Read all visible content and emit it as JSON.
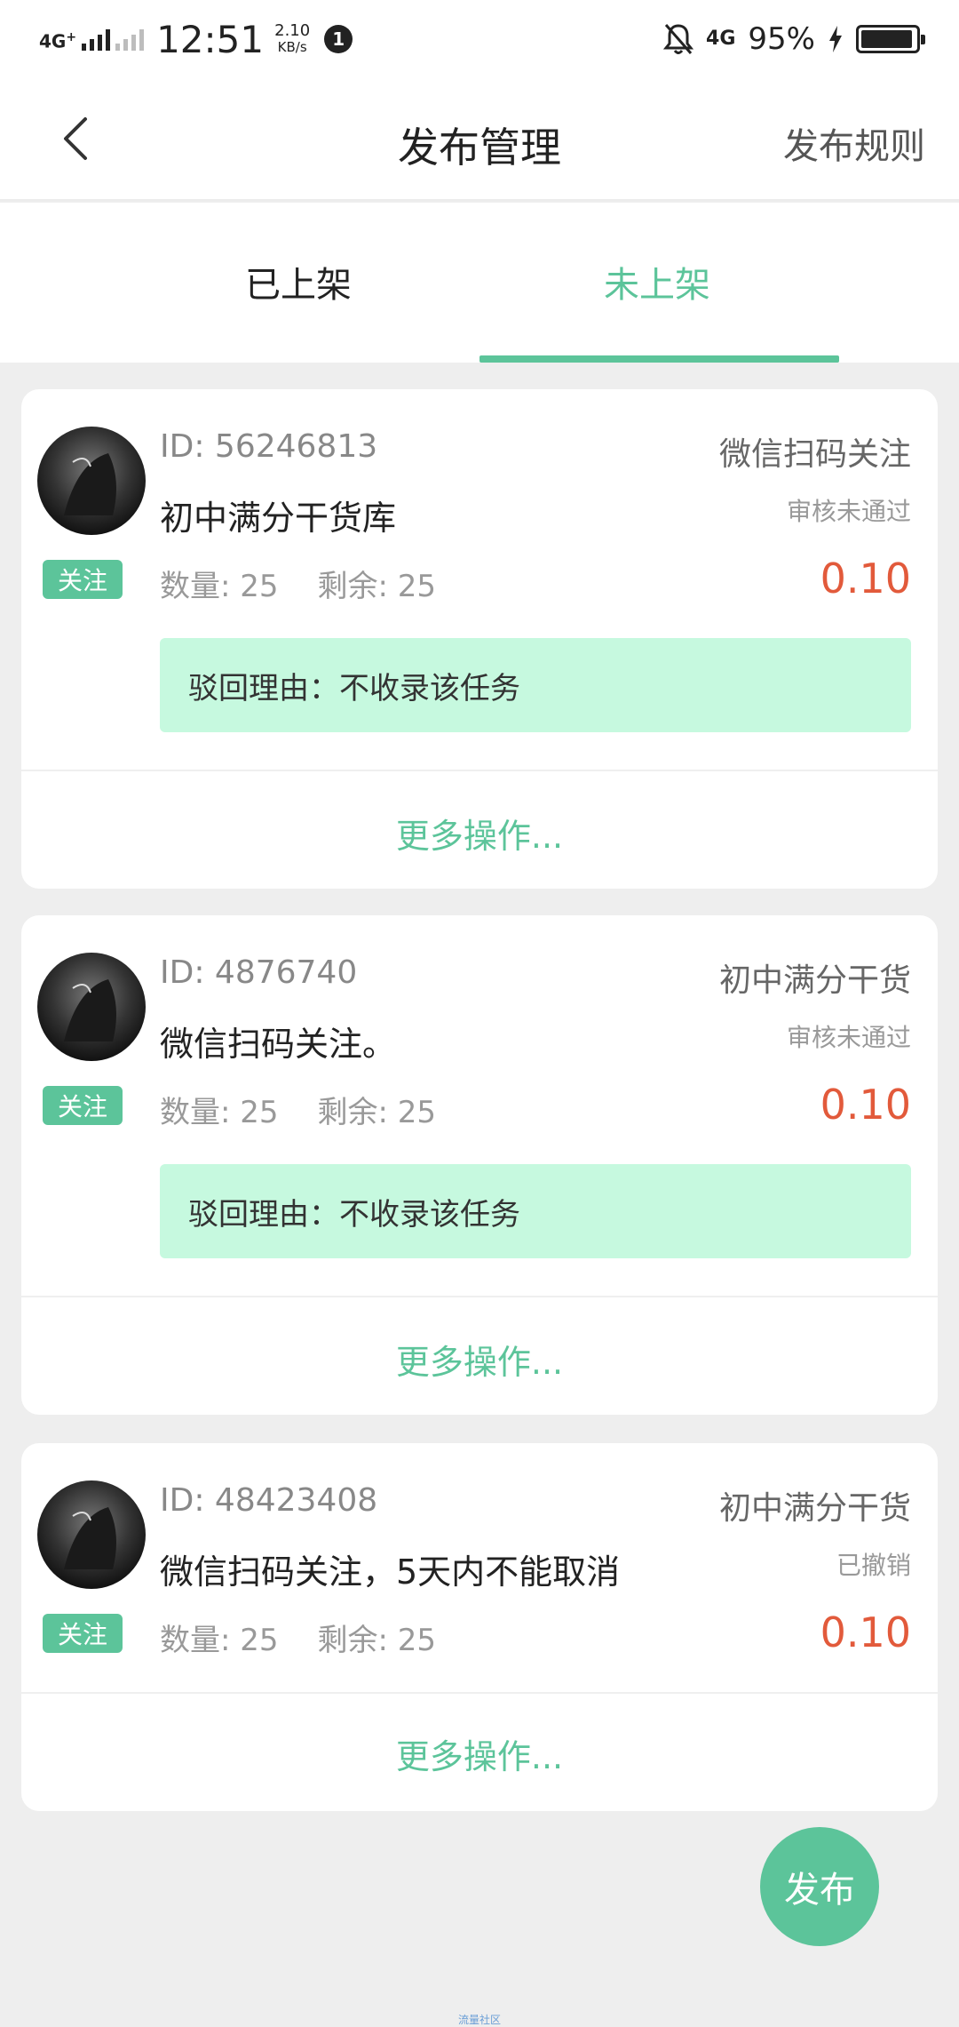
{
  "status_bar": {
    "network": "4G",
    "network_sup": "+",
    "time": "12:51",
    "speed_value": "2.10",
    "speed_unit": "KB/s",
    "notif_count": "1",
    "right_network": "4G",
    "battery": "95%",
    "battery_level": 0.95
  },
  "header": {
    "title": "发布管理",
    "right_action": "发布规则",
    "back_icon": "back-arrow-icon"
  },
  "tabs": [
    {
      "label": "已上架",
      "active": false
    },
    {
      "label": "未上架",
      "active": true
    }
  ],
  "accent_color": "#5cc49a",
  "price_color": "#e25a3b",
  "cards": [
    {
      "id": "ID: 56246813",
      "category": "微信扫码关注",
      "title": "初中满分干货库",
      "status": "审核未通过",
      "tag": "关注",
      "qty_label": "数量:  25",
      "remain_label": "剩余: 25",
      "price": "0.10",
      "reason": "驳回理由：不收录该任务",
      "more": "更多操作..."
    },
    {
      "id": "ID: 4876740",
      "category": "初中满分干货",
      "title": "微信扫码关注。",
      "status": "审核未通过",
      "tag": "关注",
      "qty_label": "数量:  25",
      "remain_label": "剩余: 25",
      "price": "0.10",
      "reason": "驳回理由：不收录该任务",
      "more": "更多操作..."
    },
    {
      "id": "ID: 48423408",
      "category": "初中满分干货",
      "title": "微信扫码关注，5天内不能取消",
      "status": "已撤销",
      "tag": "关注",
      "qty_label": "数量:  25",
      "remain_label": "剩余: 25",
      "price": "0.10",
      "more": "更多操作..."
    }
  ],
  "fab_label": "发布",
  "watermark": "流量社区"
}
